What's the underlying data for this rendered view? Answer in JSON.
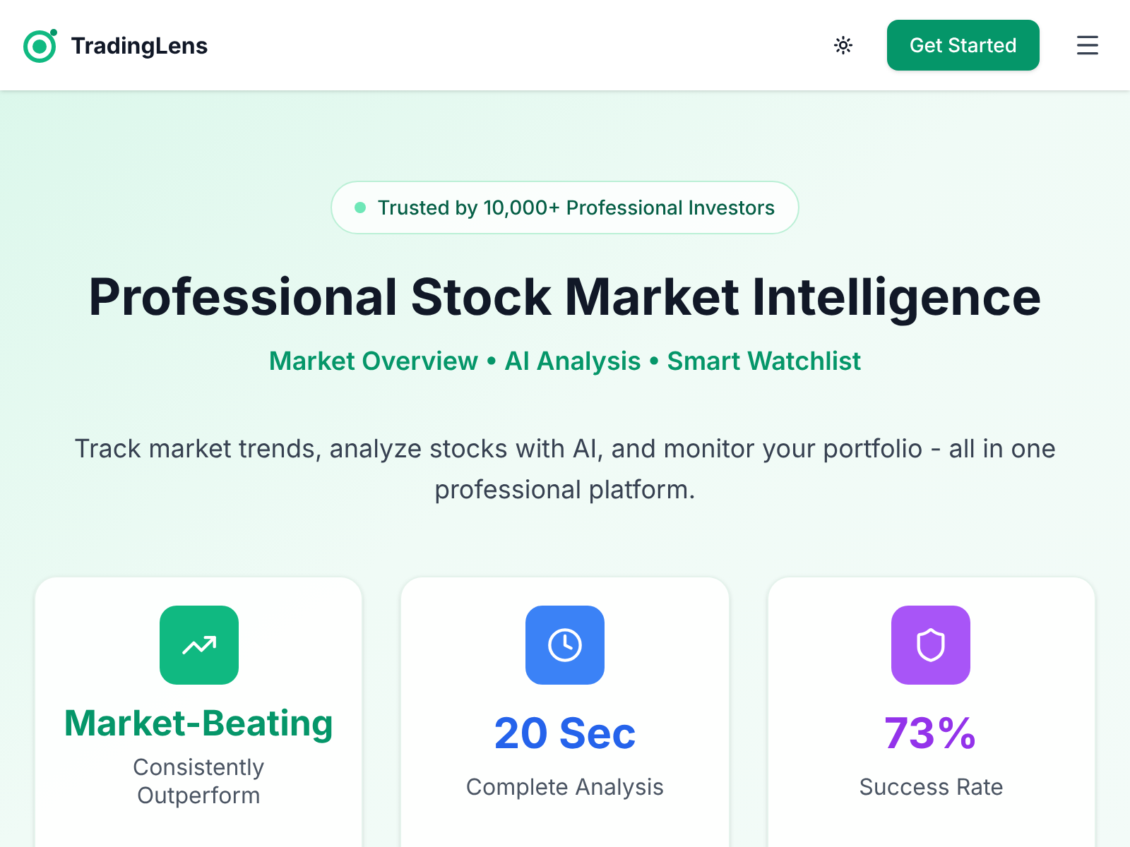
{
  "header": {
    "brand": "TradingLens",
    "cta": "Get Started"
  },
  "hero": {
    "badge": "Trusted by 10,000+ Professional Investors",
    "title": "Professional Stock Market Intelligence",
    "subtitle": "Market Overview • AI Analysis • Smart Watchlist",
    "description": "Track market trends, analyze stocks with AI, and monitor your portfolio - all in one professional platform."
  },
  "cards": [
    {
      "kind": "trend",
      "color": "#10b981",
      "value": "Market-Beating",
      "label": "Consistently Outperform"
    },
    {
      "kind": "clock",
      "color": "#3b82f6",
      "value": "20 Sec",
      "label": "Complete Analysis"
    },
    {
      "kind": "shield",
      "color": "#a855f7",
      "value": "73%",
      "label": "Success Rate"
    }
  ]
}
